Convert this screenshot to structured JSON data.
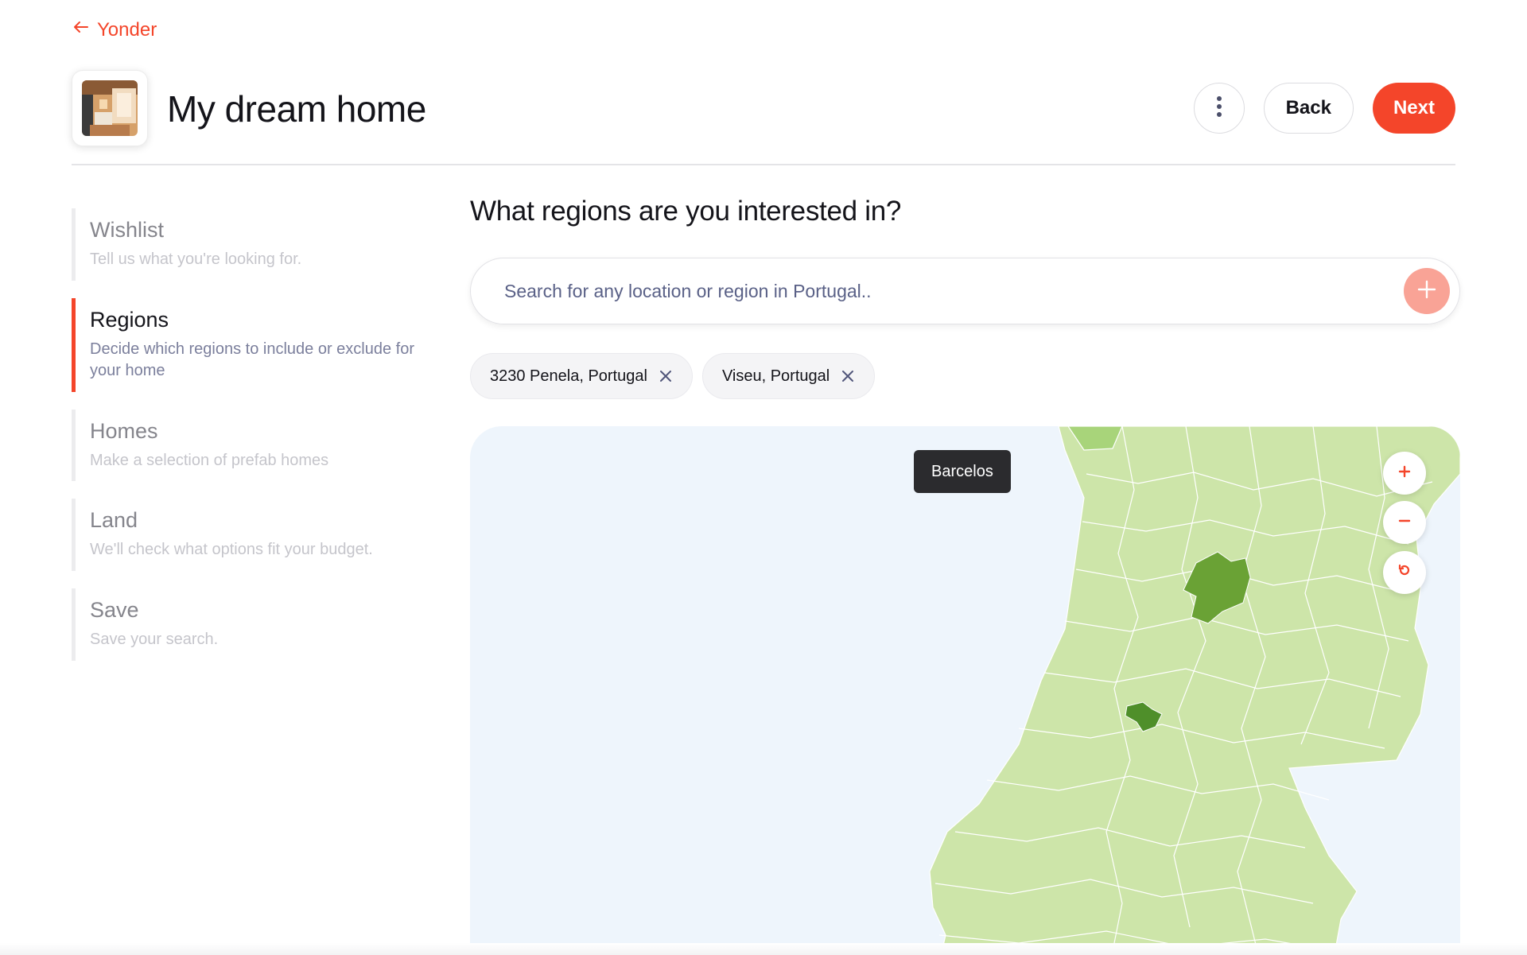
{
  "nav": {
    "back_label": "Yonder"
  },
  "header": {
    "title": "My dream home",
    "back_label": "Back",
    "next_label": "Next"
  },
  "steps": [
    {
      "title": "Wishlist",
      "description": "Tell us what you're looking for."
    },
    {
      "title": "Regions",
      "description": "Decide which regions to include or exclude for your home"
    },
    {
      "title": "Homes",
      "description": "Make a selection of prefab homes"
    },
    {
      "title": "Land",
      "description": "We'll check what options fit your budget."
    },
    {
      "title": "Save",
      "description": "Save your search."
    }
  ],
  "active_step": "Regions",
  "main": {
    "question": "What regions are you interested in?",
    "search_placeholder": "Search for any location or region in Portugal.."
  },
  "chips": [
    {
      "label": "3230 Penela, Portugal"
    },
    {
      "label": "Viseu, Portugal"
    }
  ],
  "map": {
    "tooltip": "Barcelos",
    "selected_regions": [
      "Penela",
      "Viseu"
    ]
  },
  "colors": {
    "accent": "#f4452a",
    "accent_light": "#f9a396",
    "land": "#cde5a9",
    "selected": "#6aa235",
    "sea": "#eef5fc"
  },
  "icons": {
    "back": "arrow-left-icon",
    "more": "more-vertical-icon",
    "add": "plus-icon",
    "remove": "close-icon",
    "zoom_in": "plus-icon",
    "zoom_out": "minus-icon",
    "reset": "reset-icon"
  }
}
